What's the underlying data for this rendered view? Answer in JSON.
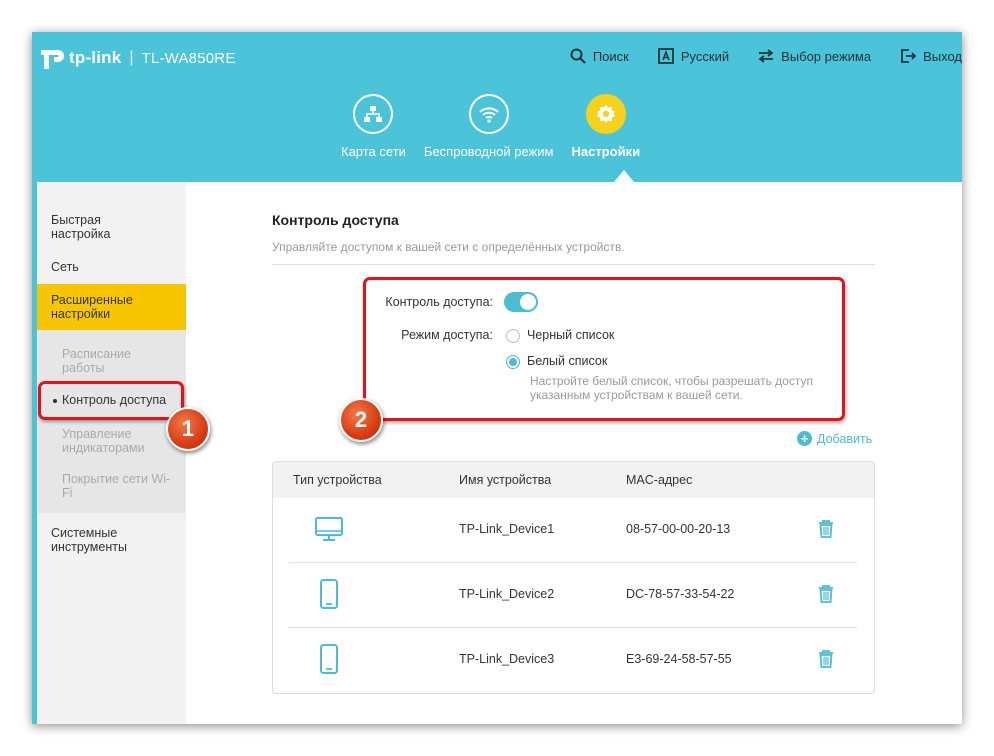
{
  "header": {
    "brand": "tp-link",
    "separator": "|",
    "model": "TL-WA850RE",
    "nav": [
      {
        "label": "Поиск",
        "icon": "search-icon"
      },
      {
        "label": "Русский",
        "icon": "language-icon"
      },
      {
        "label": "Выбор режима",
        "icon": "mode-switch-icon"
      },
      {
        "label": "Выход",
        "icon": "logout-icon"
      }
    ],
    "tabs": [
      {
        "label": "Карта сети",
        "icon": "network-map-icon",
        "active": false
      },
      {
        "label": "Беспроводной режим",
        "icon": "wireless-icon",
        "active": false
      },
      {
        "label": "Настройки",
        "icon": "settings-gear-icon",
        "active": true
      }
    ]
  },
  "sidebar": {
    "items": [
      {
        "label": "Быстрая настройка"
      },
      {
        "label": "Сеть"
      },
      {
        "label": "Расширенные настройки",
        "active": true
      },
      {
        "label": "Расписание работы"
      },
      {
        "label": "Контроль доступа",
        "active": true
      },
      {
        "label": "Управление индикаторами"
      },
      {
        "label": "Покрытие сети Wi-Fi"
      },
      {
        "label": "Системные инструменты"
      }
    ]
  },
  "main": {
    "title": "Контроль доступа",
    "description": "Управляйте доступом к вашей сети с определённых устройств.",
    "access_control_label": "Контроль доступа:",
    "access_control_enabled": true,
    "access_mode_label": "Режим доступа:",
    "mode_options": [
      {
        "label": "Черный список",
        "checked": false
      },
      {
        "label": "Белый список",
        "checked": true
      }
    ],
    "hint": "Настройте белый список, чтобы разрешать доступ указанным устройствам к вашей сети.",
    "add_label": "Добавить",
    "table": {
      "headers": [
        "Тип устройства",
        "Имя устройства",
        "MAC-адрес"
      ],
      "rows": [
        {
          "type_icon": "desktop-monitor-icon",
          "name": "TP-Link_Device1",
          "mac": "08-57-00-00-20-13"
        },
        {
          "type_icon": "smartphone-icon",
          "name": "TP-Link_Device2",
          "mac": "DC-78-57-33-54-22"
        },
        {
          "type_icon": "smartphone-icon",
          "name": "TP-Link_Device3",
          "mac": "E3-69-24-58-57-55"
        }
      ]
    }
  },
  "annotations": [
    "1",
    "2"
  ],
  "colors": {
    "header_bg": "#4bc3d9",
    "accent": "#4bbcd1",
    "active_yellow": "#f7c600",
    "callout_red": "#e3121b"
  }
}
